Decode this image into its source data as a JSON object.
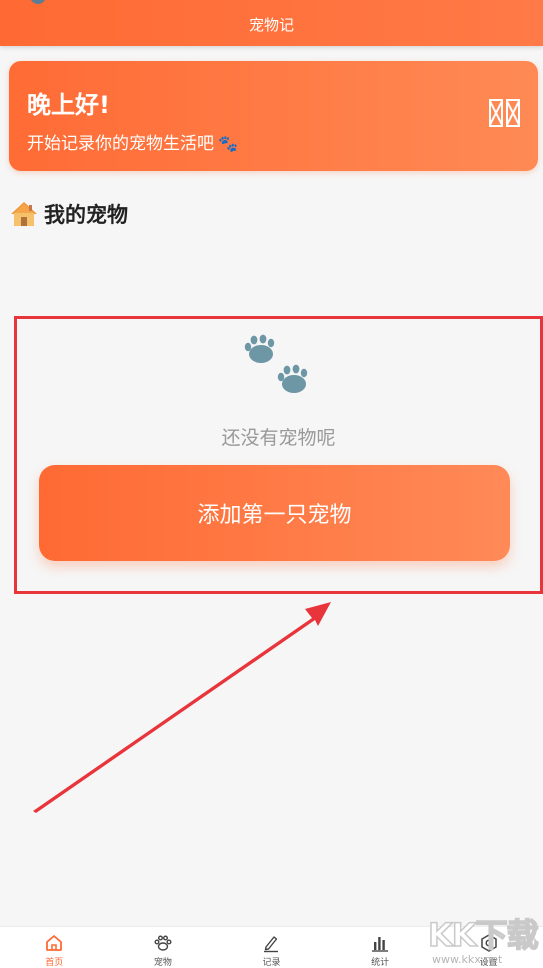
{
  "header": {
    "title": "宠物记"
  },
  "greeting": {
    "title": "晚上好!",
    "subtitle": "开始记录你的宠物生活吧",
    "subtitle_emoji": "🐾"
  },
  "section": {
    "title": "我的宠物",
    "icon": "house-icon"
  },
  "empty_state": {
    "icon": "paw-icon",
    "text": "还没有宠物呢",
    "button_label": "添加第一只宠物"
  },
  "bottom_nav": {
    "items": [
      {
        "label": "首页",
        "icon": "home-icon",
        "active": true
      },
      {
        "label": "宠物",
        "icon": "paw-icon",
        "active": false
      },
      {
        "label": "记录",
        "icon": "pencil-icon",
        "active": false
      },
      {
        "label": "统计",
        "icon": "bar-chart-icon",
        "active": false
      },
      {
        "label": "设置",
        "icon": "settings-icon",
        "active": false
      }
    ]
  },
  "watermark": {
    "text": "KK下载",
    "url": "www.kkx.net"
  },
  "colors": {
    "accent": "#ff6a33",
    "highlight_border": "#e8353b",
    "paw": "#6e97a6"
  }
}
